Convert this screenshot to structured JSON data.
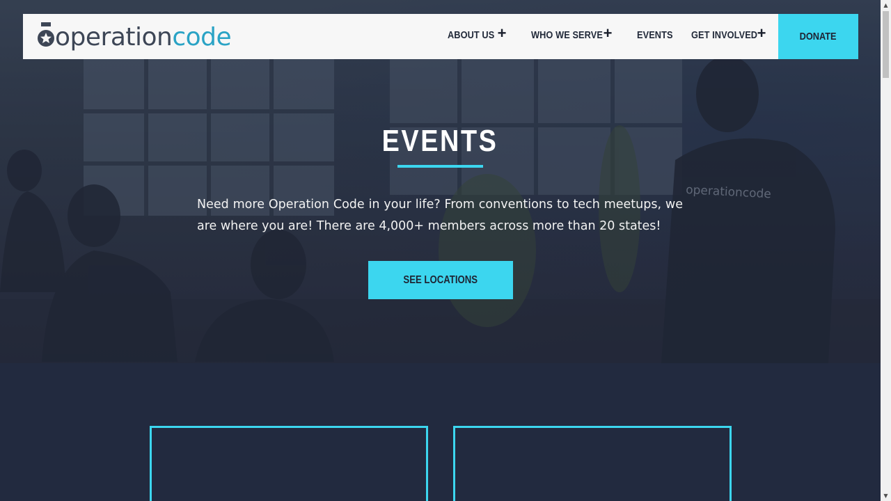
{
  "brand": {
    "logo_part1": "operation",
    "logo_part2": "code"
  },
  "nav": {
    "items": [
      {
        "label": "ABOUT US",
        "has_submenu": true
      },
      {
        "label": "WHO WE SERVE",
        "has_submenu": true
      },
      {
        "label": "EVENTS",
        "has_submenu": false
      },
      {
        "label": "GET INVOLVED",
        "has_submenu": true
      }
    ],
    "submenu_icon": "+",
    "donate_label": "DONATE"
  },
  "hero": {
    "title": "EVENTS",
    "description": "Need more Operation Code in your life? From conventions to tech meetups, we are where you are! There are 4,000+ members across more than 20 states!",
    "cta_label": "SEE LOCATIONS",
    "shirt_text": "operationcode"
  },
  "colors": {
    "accent": "#3cd6ef",
    "dark_bg": "#222a3f",
    "nav_bg": "#f7f7f7",
    "logo_dark": "#3d4656",
    "logo_blue": "#2aa3c5"
  },
  "icons": {
    "logo_medal": "medal-star-icon",
    "plus": "plus-icon",
    "scroll_up": "chevron-up-icon",
    "scroll_down": "chevron-down-icon"
  }
}
